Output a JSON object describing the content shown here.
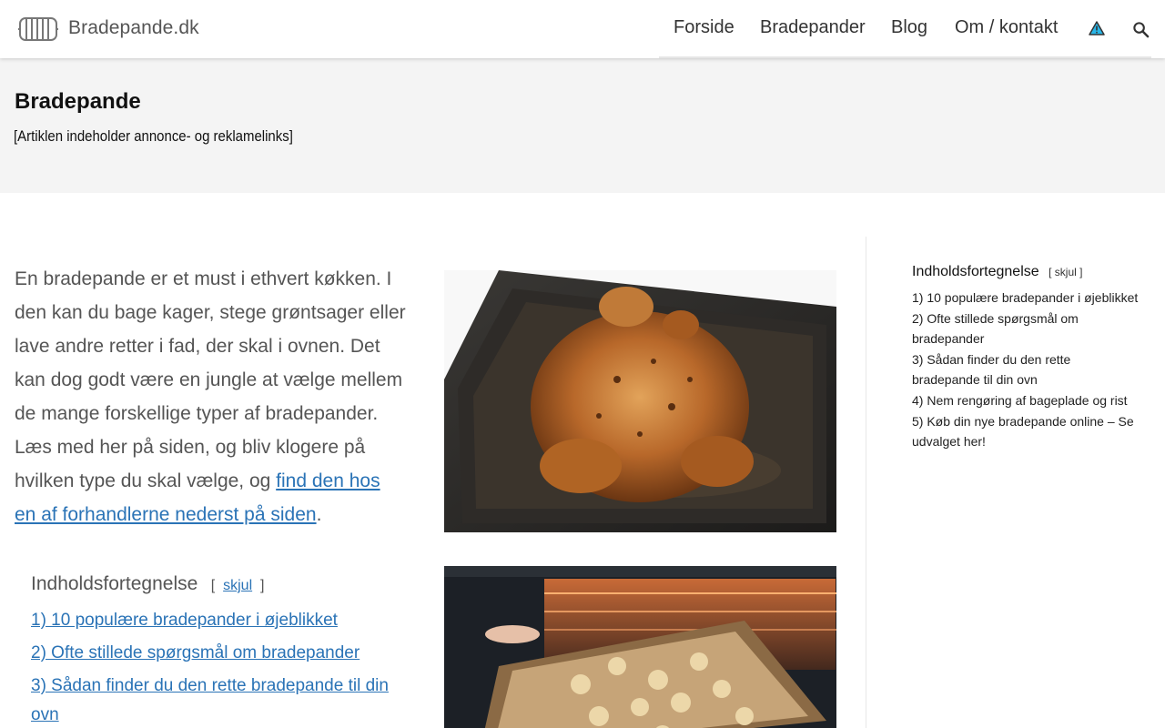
{
  "header": {
    "brand": "Bradepande.dk",
    "nav": [
      {
        "label": "Forside"
      },
      {
        "label": "Bradepander"
      },
      {
        "label": "Blog"
      },
      {
        "label": "Om / kontakt"
      }
    ],
    "icons": [
      "grill-logo-icon",
      "warning-icon",
      "search-icon"
    ]
  },
  "hero": {
    "title": "Bradepande",
    "subtitle": "[Artiklen indeholder annonce- og reklamelinks]"
  },
  "intro": {
    "text": "En bradepande er et must i ethvert køkken. I den kan du bage kager, stege grøntsager eller lave andre retter i fad, der skal i ovnen. Det kan dog godt være en jungle at vælge mellem de mange forskellige typer af bradepander. Læs med her på siden, og bliv klogere på hvilken type du skal vælge, og ",
    "link": "find den hos en af forhandlerne nederst på siden",
    "end": "."
  },
  "toc_main": {
    "title": "Indholdsfortegnelse",
    "bracket_open": "[",
    "toggle": "skjul",
    "bracket_close": "]",
    "items": [
      "1) 10 populære bradepander i øjeblikket",
      "2) Ofte stillede spørgsmål om bradepander",
      "3) Sådan finder du den rette bradepande til din ovn"
    ]
  },
  "toc_side": {
    "title": "Indholdsfortegnelse",
    "toggle": "[ skjul ]",
    "items": [
      "1) 10 populære bradepander i øjeblikket",
      "2) Ofte stillede spørgsmål om bradepander",
      "3) Sådan finder du den rette bradepande til din ovn",
      "4) Nem rengøring af bageplade og rist",
      "5) Køb din nye bradepande online – Se udvalget her!"
    ]
  },
  "colors": {
    "link": "#2a73b6",
    "hero_bg": "#f4f4f4",
    "warning_fill": "#29b6e8"
  }
}
